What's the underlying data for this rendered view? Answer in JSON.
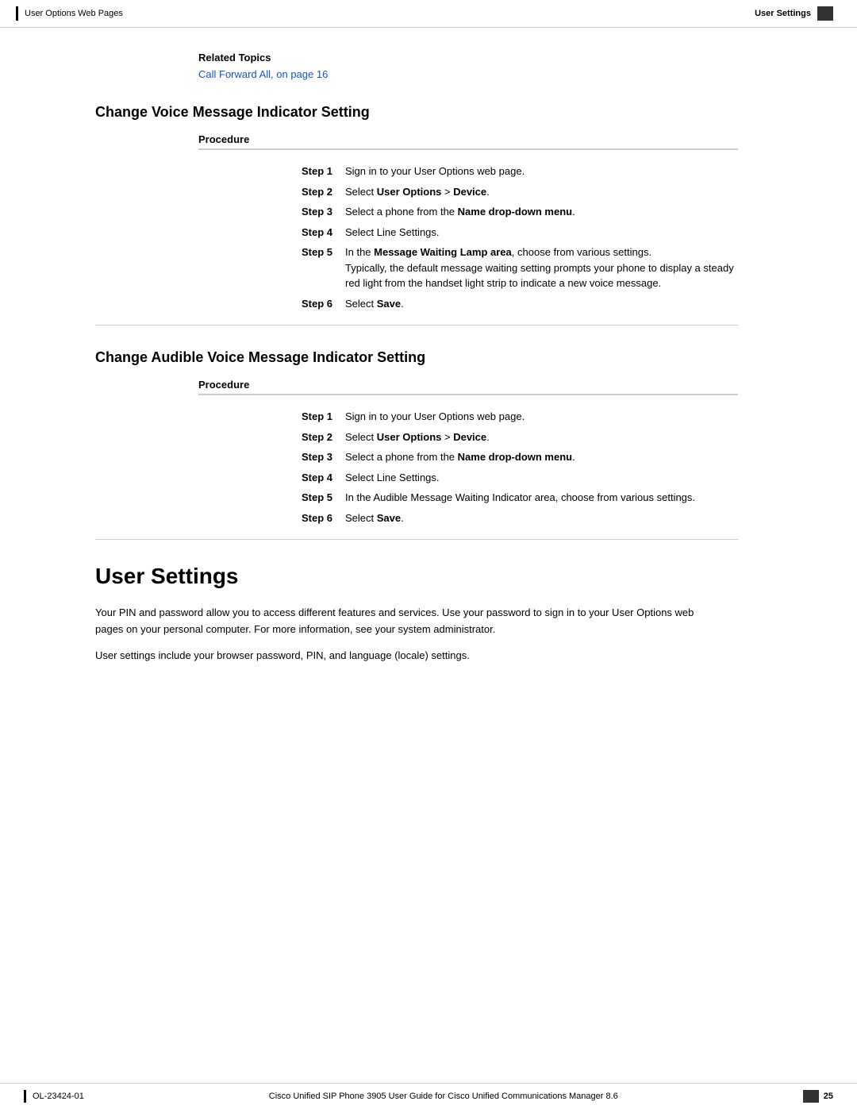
{
  "header": {
    "left_bar_label": "User Options Web Pages",
    "right_label": "User Settings"
  },
  "related_topics": {
    "title": "Related Topics",
    "link_text": "Call Forward All,  on page 16"
  },
  "section1": {
    "title": "Change Voice Message Indicator Setting",
    "procedure_label": "Procedure",
    "steps": [
      {
        "label": "Step 1",
        "text": "Sign in to your User Options web page."
      },
      {
        "label": "Step 2",
        "text_before": "Select ",
        "bold1": "User Options",
        "text_mid": " > ",
        "bold2": "Device",
        "text_after": "."
      },
      {
        "label": "Step 3",
        "text_before": "Select a phone from the ",
        "bold1": "Name drop-down menu",
        "text_after": "."
      },
      {
        "label": "Step 4",
        "text": "Select Line Settings."
      },
      {
        "label": "Step 5",
        "text_before": "In the ",
        "bold1": "Message Waiting Lamp area",
        "text_after": ", choose from various settings.",
        "subtext": "Typically, the default message waiting setting prompts your phone to display a steady red light from the handset light strip to indicate a new voice message."
      },
      {
        "label": "Step 6",
        "text_before": "Select ",
        "bold1": "Save",
        "text_after": "."
      }
    ]
  },
  "section2": {
    "title": "Change Audible Voice Message Indicator Setting",
    "procedure_label": "Procedure",
    "steps": [
      {
        "label": "Step 1",
        "text": "Sign in to your User Options web page."
      },
      {
        "label": "Step 2",
        "text_before": "Select ",
        "bold1": "User Options",
        "text_mid": " > ",
        "bold2": "Device",
        "text_after": "."
      },
      {
        "label": "Step 3",
        "text_before": "Select a phone from the ",
        "bold1": "Name drop-down menu",
        "text_after": "."
      },
      {
        "label": "Step 4",
        "text": "Select Line Settings."
      },
      {
        "label": "Step 5",
        "text": "In the Audible Message Waiting Indicator area, choose from various settings."
      },
      {
        "label": "Step 6",
        "text_before": "Select ",
        "bold1": "Save",
        "text_after": "."
      }
    ]
  },
  "user_settings": {
    "title": "User Settings",
    "para1": "Your PIN and password allow you to access different features and services. Use your password to sign in to your User Options web pages on your personal computer. For more information, see your system administrator.",
    "para2": "User settings include your browser password, PIN, and language (locale) settings."
  },
  "footer": {
    "left_text": "OL-23424-01",
    "center_text": "Cisco Unified SIP Phone 3905 User Guide for Cisco Unified Communications Manager 8.6",
    "page_number": "25"
  }
}
